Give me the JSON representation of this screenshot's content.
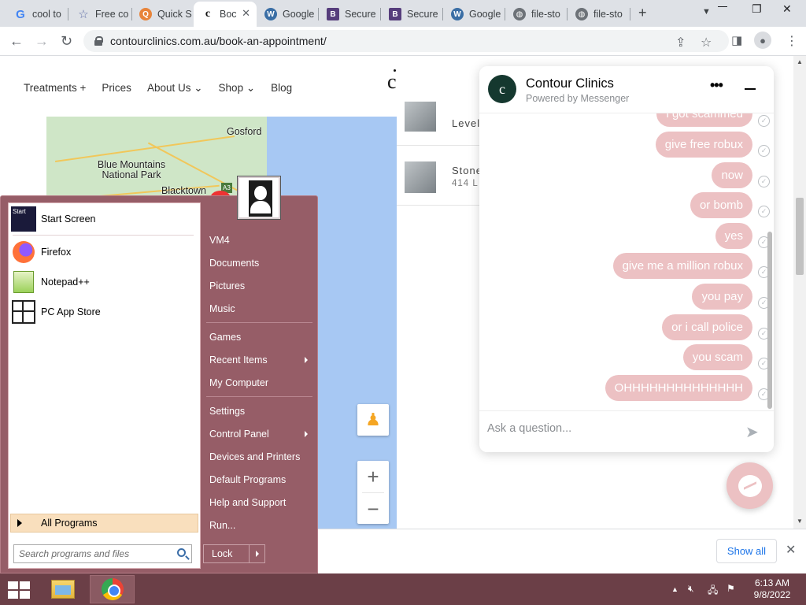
{
  "browser": {
    "tabs": [
      {
        "title": "cool to",
        "favicon": "google-icon"
      },
      {
        "title": "Free co",
        "favicon": "star-icon"
      },
      {
        "title": "Quick S",
        "favicon": "quick-icon"
      },
      {
        "title": "Boc",
        "favicon": "contour-icon",
        "active": true
      },
      {
        "title": "Google",
        "favicon": "wordpress-icon"
      },
      {
        "title": "Secure",
        "favicon": "bootstrap-icon"
      },
      {
        "title": "Secure",
        "favicon": "bootstrap-icon"
      },
      {
        "title": "Google",
        "favicon": "wordpress-icon"
      },
      {
        "title": "file-sto",
        "favicon": "globe-icon"
      },
      {
        "title": "file-sto",
        "favicon": "globe-icon"
      }
    ],
    "url": "contourclinics.com.au/book-an-appointment/"
  },
  "site": {
    "nav": [
      "Treatments",
      "Prices",
      "About Us",
      "Shop",
      "Blog"
    ],
    "logo": "c",
    "locations": [
      {
        "t1": "Level",
        "t2": ""
      },
      {
        "t1": "Stone",
        "t2": "414 L"
      }
    ]
  },
  "map": {
    "labels": {
      "gosford": "Gosford",
      "blue_mountains": "Blue Mountains National Park",
      "blacktown": "Blacktown",
      "a3": "A3"
    }
  },
  "chat": {
    "name": "Contour Clinics",
    "subtitle": "Powered by Messenger",
    "messages": [
      "i got scammed",
      "give free robux",
      "now",
      "or bomb",
      "yes",
      "give me a million robux",
      "you pay",
      "or i call police",
      "you scam",
      "OHHHHHHHHHHHHHH"
    ],
    "input_placeholder": "Ask a question..."
  },
  "downloads": {
    "show_all": "Show all"
  },
  "start_menu": {
    "left_items": [
      {
        "label": "Start Screen",
        "icon": "start-screen-icon"
      },
      {
        "label": "Firefox",
        "icon": "firefox-icon"
      },
      {
        "label": "Notepad++",
        "icon": "notepad-icon"
      },
      {
        "label": "PC App Store",
        "icon": "app-store-icon"
      }
    ],
    "all_programs": "All Programs",
    "search_placeholder": "Search programs and files",
    "right_items": [
      "VM4",
      "Documents",
      "Pictures",
      "Music",
      "Games",
      "Recent Items",
      "My Computer",
      "Settings",
      "Control Panel",
      "Devices and Printers",
      "Default Programs",
      "Help and Support",
      "Run..."
    ],
    "lock": "Lock"
  },
  "taskbar": {
    "time": "6:13 AM",
    "date": "9/8/2022"
  },
  "colors": {
    "chat_bubble": "#ecc1c3",
    "start_menu": "#965d67",
    "taskbar": "#6b3f47"
  }
}
